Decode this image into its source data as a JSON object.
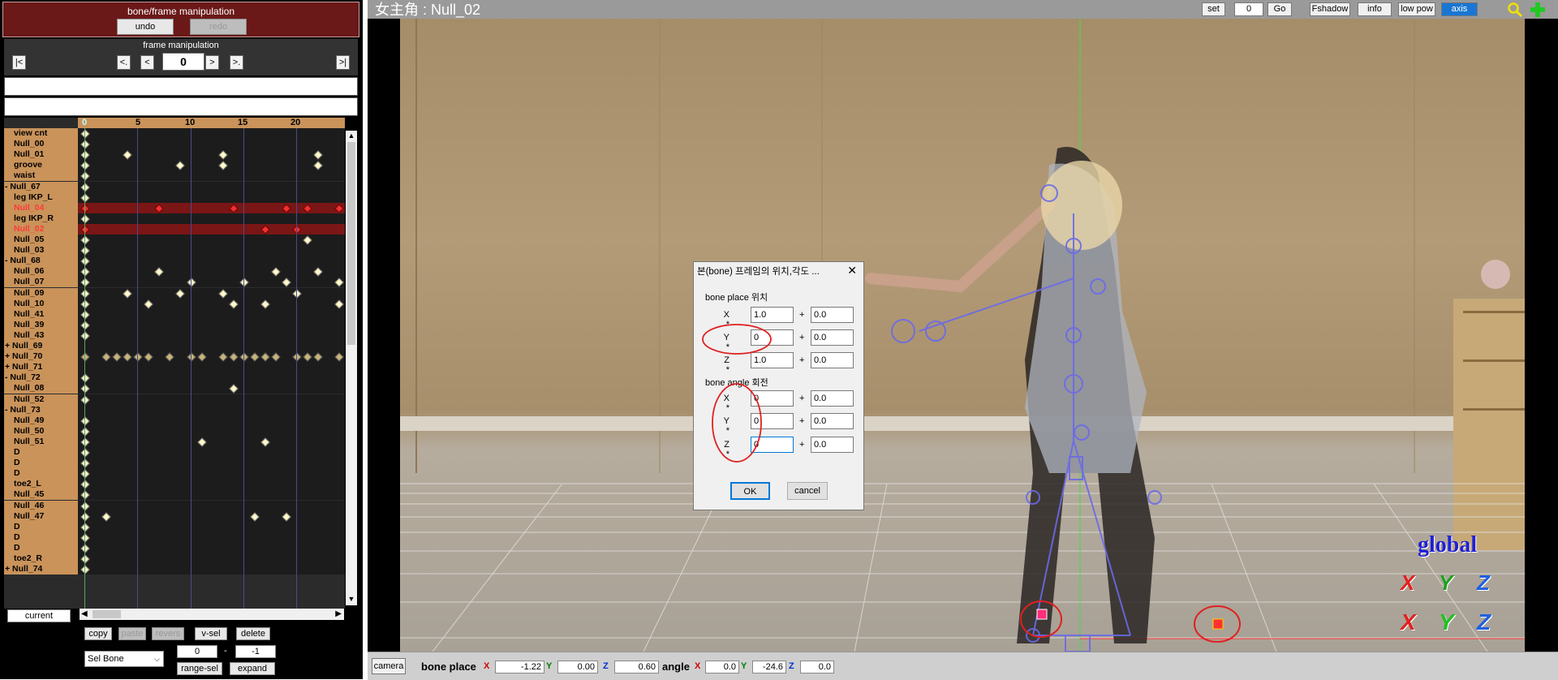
{
  "left_panel": {
    "header_title": "bone/frame manipulation",
    "undo_label": "undo",
    "redo_label": "redo",
    "frame_title": "frame manipulation",
    "nav_first": "|<",
    "nav_prev_key": "<.",
    "nav_prev": "<",
    "frame_value": "0",
    "nav_next": ">",
    "nav_next_key": ">.",
    "nav_last": ">|",
    "timeline_ticks": [
      "0",
      "5",
      "10",
      "15",
      "20"
    ],
    "bones": [
      "view cnt",
      "Null_00",
      "Null_01",
      "groove",
      "waist",
      "- Null_67",
      "leg IKP_L",
      "Null_04",
      "leg IKP_R",
      "Null_02",
      "Null_05",
      "Null_03",
      "- Null_68",
      "Null_06",
      "Null_07",
      "Null_09",
      "Null_10",
      "Null_41",
      "Null_39",
      "Null_43",
      "+ Null_69",
      "+ Null_70",
      "+ Null_71",
      "- Null_72",
      "Null_08",
      "Null_52",
      "- Null_73",
      "Null_49",
      "Null_50",
      "Null_51",
      "D",
      "D",
      "D",
      "toe2_L",
      "Null_45",
      "Null_46",
      "Null_47",
      "D",
      "D",
      "D",
      "toe2_R",
      "+ Null_74"
    ],
    "current_label": "current",
    "copy_label": "copy",
    "paste_label": "paste",
    "revers_label": "revers",
    "vsel_label": "v-sel",
    "delete_label": "delete",
    "select_value": "Sel Bone",
    "range_from": "0",
    "range_dash": "-",
    "range_to": "-1",
    "rangesel_label": "range-sel",
    "expand_label": "expand"
  },
  "toolbar": {
    "title": "女主角 : Null_02",
    "set_label": "set",
    "frame_input": "0",
    "go_label": "Go",
    "fshadow_label": "Fshadow",
    "info_label": "info",
    "lowpow_label": "low pow",
    "axis_label": "axis"
  },
  "viewport": {
    "global_label": "global",
    "axis_x": "X",
    "axis_y": "Y",
    "axis_z": "Z"
  },
  "dialog": {
    "caption": "본(bone) 프레임의 위치,각도 ...",
    "close": "✕",
    "place_group": "bone place 위치",
    "angle_group": "bone angle 회전",
    "x_label": "X *",
    "y_label": "Y *",
    "z_label": "Z *",
    "plus": "+",
    "place": {
      "x_mul": "1.0",
      "x_add": "0.0",
      "y_mul": "0",
      "y_add": "0.0",
      "z_mul": "1.0",
      "z_add": "0.0"
    },
    "angle": {
      "x_mul": "0",
      "x_add": "0.0",
      "y_mul": "0",
      "y_add": "0.0",
      "z_mul": "0",
      "z_add": "0.0"
    },
    "ok_label": "OK",
    "cancel_label": "cancel"
  },
  "statusbar": {
    "camera_label": "camera",
    "place_label": "bone place",
    "angle_label": "angle",
    "x": "X",
    "y": "Y",
    "z": "Z",
    "place_x": "-1.22",
    "place_y": "0.00",
    "place_z": "0.60",
    "angle_x": "0.0",
    "angle_y": "-24.6",
    "angle_z": "0.0"
  },
  "colors": {
    "axis_active": "#1976d2",
    "panel_header": "#6b1818",
    "track_selected": "#7a1616",
    "label_bg": "#c9935a"
  },
  "icons": [
    "zoom-icon",
    "add-icon",
    "close-icon",
    "chevron-down-icon"
  ]
}
